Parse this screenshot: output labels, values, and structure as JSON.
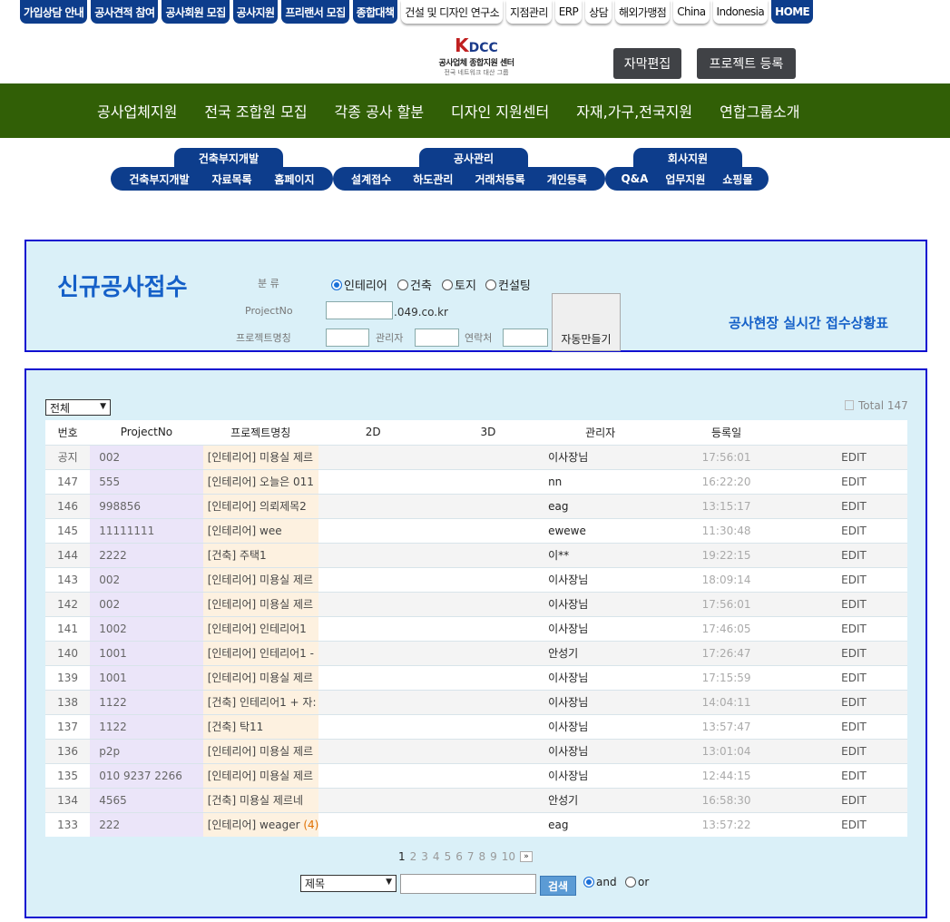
{
  "topnav": [
    {
      "label": "가입상담 안내",
      "style": "blue"
    },
    {
      "label": "공사견적 참여",
      "style": "blue"
    },
    {
      "label": "공사회원 모집",
      "style": "blue"
    },
    {
      "label": "공사지원",
      "style": "blue"
    },
    {
      "label": "프리랜서 모집",
      "style": "blue"
    },
    {
      "label": "종합대책",
      "style": "blue"
    },
    {
      "label": "건설 및 디자인 연구소",
      "style": "white"
    },
    {
      "label": "지점관리",
      "style": "white"
    },
    {
      "label": "ERP",
      "style": "white"
    },
    {
      "label": "상담",
      "style": "white"
    },
    {
      "label": "해외가맹점",
      "style": "white"
    },
    {
      "label": "China",
      "style": "white"
    },
    {
      "label": "Indonesia",
      "style": "white"
    },
    {
      "label": "HOME",
      "style": "blue"
    }
  ],
  "logo": {
    "mark_k": "K",
    "mark_rest": "DCC",
    "line1": "공사업체 종합지원 센터",
    "line2": "전국 네트워크 대산 그룹"
  },
  "header_buttons": {
    "caption_edit": "자막편집",
    "project_register": "프로젝트 등록"
  },
  "main_menu": [
    "공사업체지원",
    "전국 조합원 모집",
    "각종 공사 할분",
    "디자인 지원센터",
    "자재,가구,전국지원",
    "연합그룹소개"
  ],
  "categories": [
    {
      "caption": "건축부지개발",
      "links": [
        "건축부지개발",
        "자료목록",
        "홈페이지"
      ]
    },
    {
      "caption": "공사관리",
      "links": [
        "설계접수",
        "하도관리",
        "거래처등록",
        "개인등록"
      ]
    },
    {
      "caption": "회사지원",
      "links": [
        "Q&A",
        "업무지원",
        "쇼핑몰"
      ]
    }
  ],
  "form": {
    "title": "신규공사접수",
    "type_label": "분 류",
    "type_options": [
      "인테리어",
      "건축",
      "토지",
      "컨설팅"
    ],
    "type_selected": "인테리어",
    "projectno_label": "ProjectNo",
    "domain_suffix": ".049.co.kr",
    "project_name_label": "프로젝트명칭",
    "manager_label": "관리자",
    "contact_label": "연락처",
    "auto_button": "자동만들기",
    "live_status_link": "공사현장 실시간 접수상황표"
  },
  "list": {
    "filter_value": "전체",
    "total": "Total 147",
    "columns": [
      "번호",
      "ProjectNo",
      "프로젝트명칭",
      "2D",
      "3D",
      "관리자",
      "등록일"
    ],
    "rows": [
      {
        "num": "공지",
        "projectno": "002",
        "name": "[인테리어] 미용실 제르",
        "comments": "",
        "manager": "이사장님",
        "date": "17:56:01",
        "action": "EDIT"
      },
      {
        "num": "147",
        "projectno": "555",
        "name": "[인테리어] 오늘은 011",
        "comments": "",
        "manager": "nn",
        "date": "16:22:20",
        "action": "EDIT"
      },
      {
        "num": "146",
        "projectno": "998856",
        "name": "[인테리어] 의뢰제목2",
        "comments": "",
        "manager": "eag",
        "date": "13:15:17",
        "action": "EDIT"
      },
      {
        "num": "145",
        "projectno": "11111111",
        "name": "[인테리어] wee",
        "comments": "",
        "manager": "ewewe",
        "date": "11:30:48",
        "action": "EDIT"
      },
      {
        "num": "144",
        "projectno": "2222",
        "name": "[건축] 주택1",
        "comments": "",
        "manager": "이**",
        "date": "19:22:15",
        "action": "EDIT"
      },
      {
        "num": "143",
        "projectno": "002",
        "name": "[인테리어] 미용실 제르",
        "comments": "",
        "manager": "이사장님",
        "date": "18:09:14",
        "action": "EDIT"
      },
      {
        "num": "142",
        "projectno": "002",
        "name": "[인테리어] 미용실 제르",
        "comments": "",
        "manager": "이사장님",
        "date": "17:56:01",
        "action": "EDIT"
      },
      {
        "num": "141",
        "projectno": "1002",
        "name": "[인테리어] 인테리어1",
        "comments": "",
        "manager": "이사장님",
        "date": "17:46:05",
        "action": "EDIT"
      },
      {
        "num": "140",
        "projectno": "1001",
        "name": "[인테리어] 인테리어1 -",
        "comments": "",
        "manager": "안성기",
        "date": "17:26:47",
        "action": "EDIT"
      },
      {
        "num": "139",
        "projectno": "1001",
        "name": "[인테리어] 미용실 제르",
        "comments": "",
        "manager": "이사장님",
        "date": "17:15:59",
        "action": "EDIT"
      },
      {
        "num": "138",
        "projectno": "1122",
        "name": "[건축] 인테리어1 + 자:",
        "comments": "",
        "manager": "이사장님",
        "date": "14:04:11",
        "action": "EDIT"
      },
      {
        "num": "137",
        "projectno": "1122",
        "name": "[건축] 탁11",
        "comments": "",
        "manager": "이사장님",
        "date": "13:57:47",
        "action": "EDIT"
      },
      {
        "num": "136",
        "projectno": "p2p",
        "name": "[인테리어] 미용실 제르",
        "comments": "",
        "manager": "이사장님",
        "date": "13:01:04",
        "action": "EDIT"
      },
      {
        "num": "135",
        "projectno": "010 9237 2266",
        "name": "[인테리어] 미용실 제르",
        "comments": "",
        "manager": "이사장님",
        "date": "12:44:15",
        "action": "EDIT"
      },
      {
        "num": "134",
        "projectno": "4565",
        "name": "[건축] 미용실 제르네",
        "comments": "",
        "manager": "안성기",
        "date": "16:58:30",
        "action": "EDIT"
      },
      {
        "num": "133",
        "projectno": "222",
        "name": "[인테리어] weager",
        "comments": "(4)",
        "manager": "eag",
        "date": "13:57:22",
        "action": "EDIT"
      }
    ]
  },
  "pagination": {
    "pages": [
      "1",
      "2",
      "3",
      "4",
      "5",
      "6",
      "7",
      "8",
      "9",
      "10"
    ],
    "current": "1",
    "next": "»"
  },
  "search": {
    "field_value": "제목",
    "button": "검색",
    "op_and": "and",
    "op_or": "or",
    "selected": "and"
  }
}
